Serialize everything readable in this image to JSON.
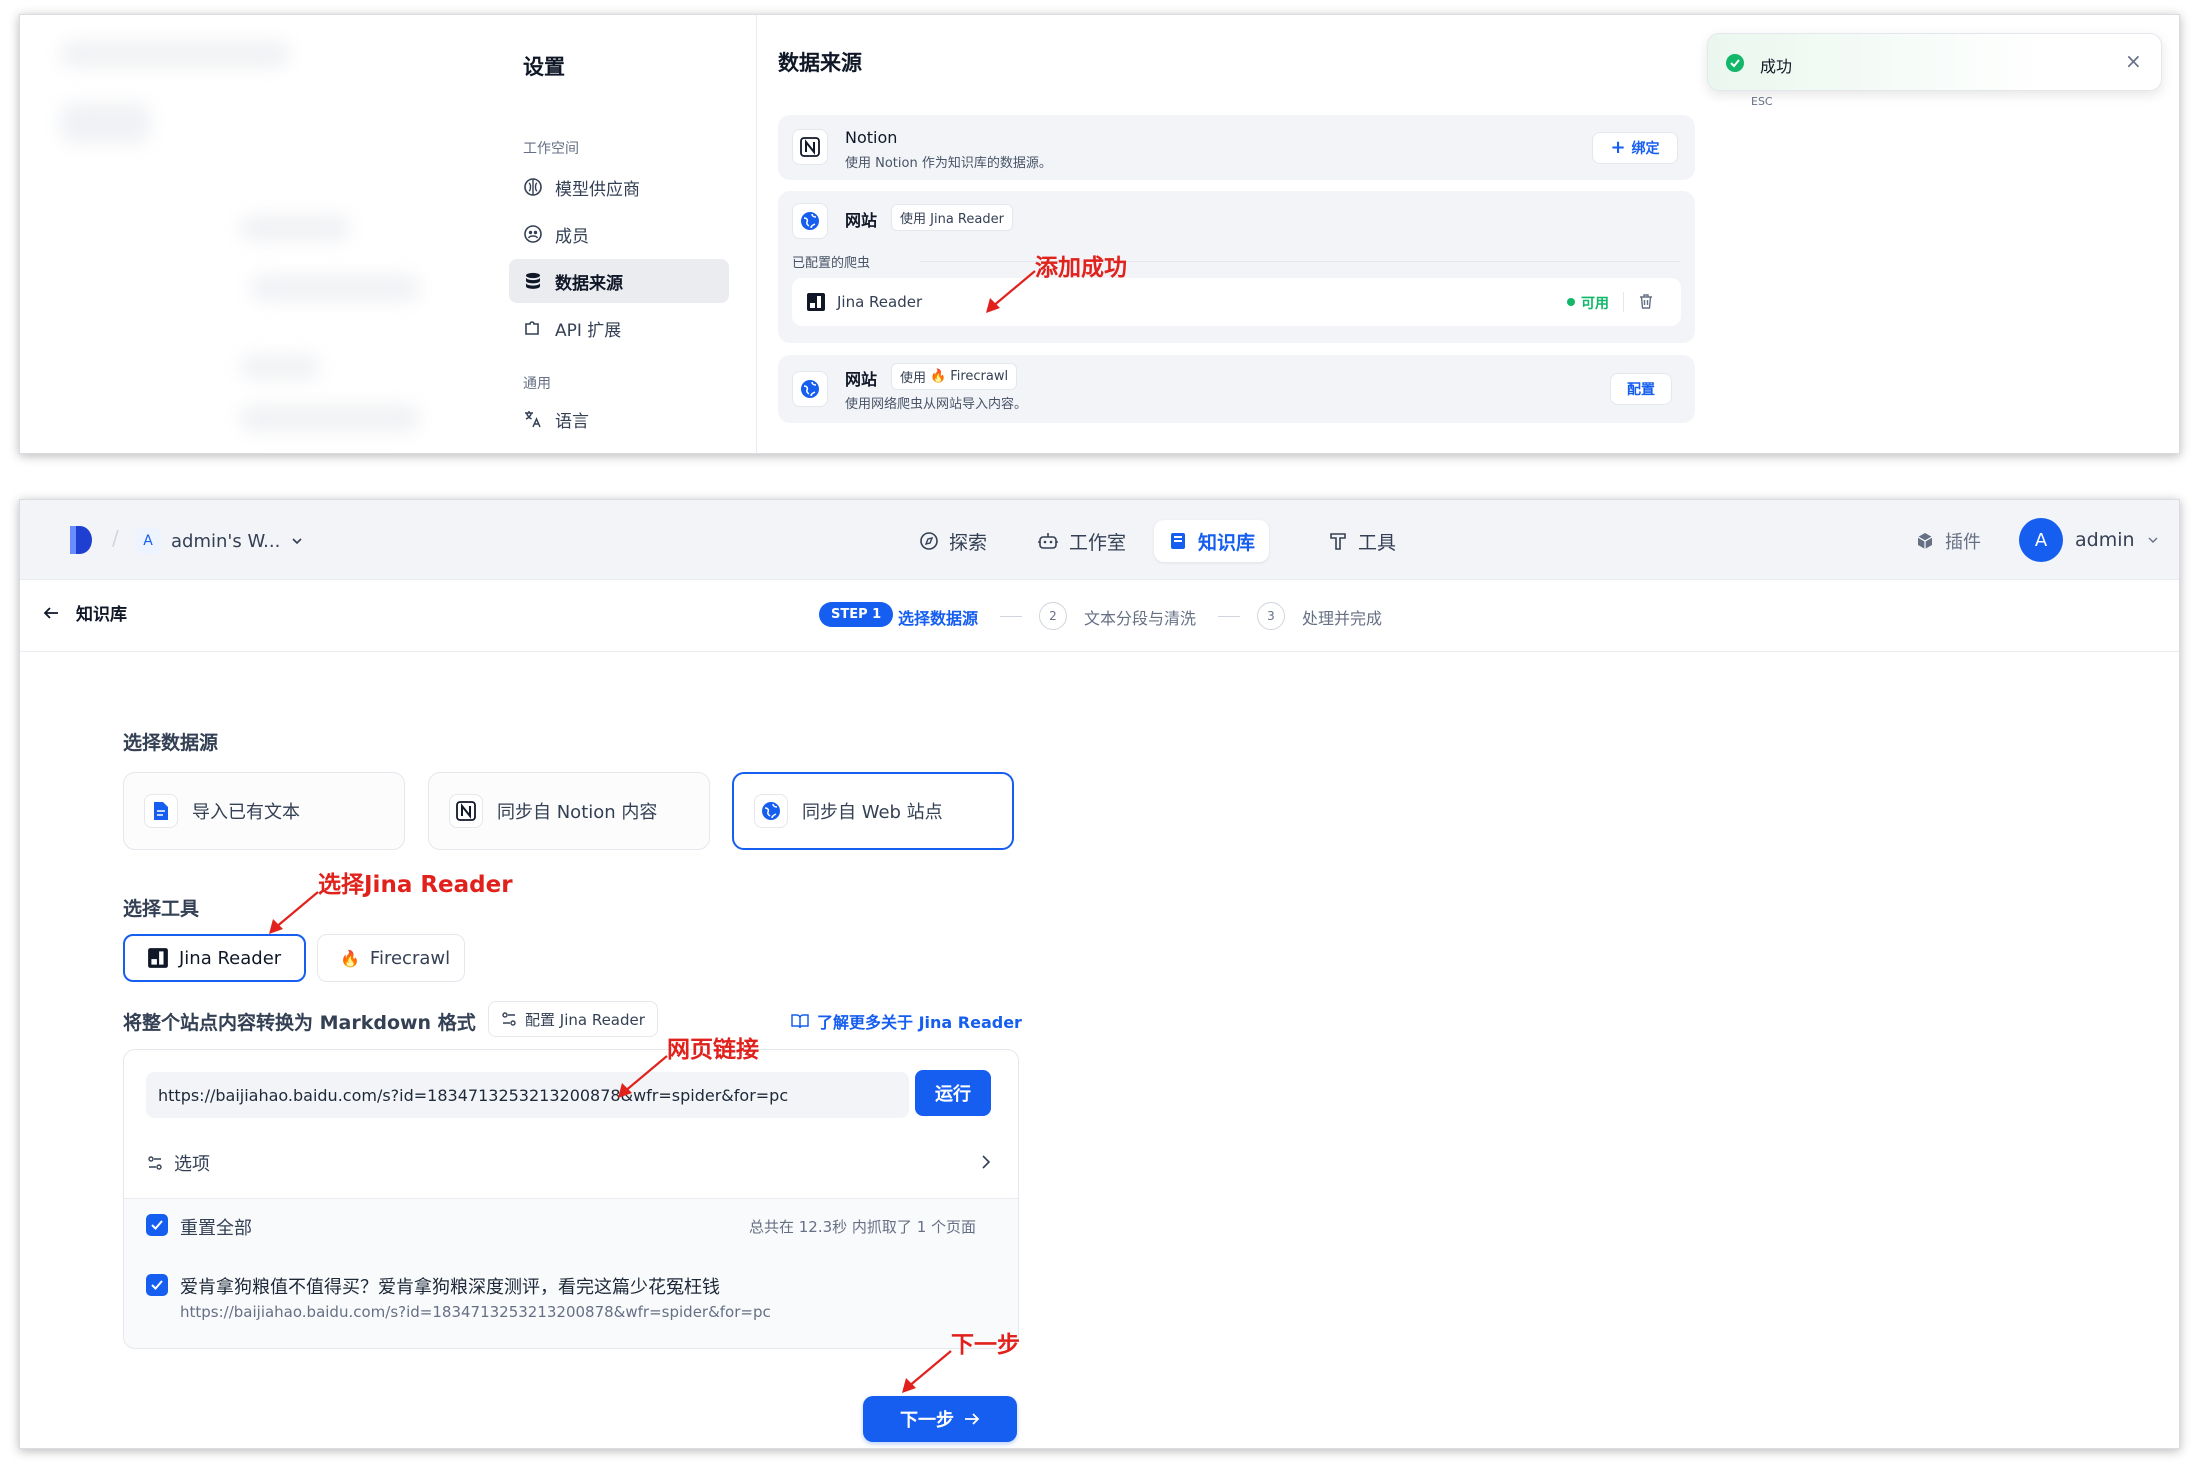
{
  "settings": {
    "title": "设置",
    "group_workspace": "工作空间",
    "group_general": "通用",
    "nav": [
      {
        "label": "模型供应商"
      },
      {
        "label": "成员"
      },
      {
        "label": "数据来源"
      },
      {
        "label": "API 扩展"
      },
      {
        "label": "语言"
      }
    ]
  },
  "datasource": {
    "title": "数据来源",
    "notion": {
      "name": "Notion",
      "desc": "使用 Notion 作为知识库的数据源。",
      "bind_label": "绑定"
    },
    "jina": {
      "name": "网站",
      "tag": "使用 Jina Reader",
      "configured_label": "已配置的爬虫",
      "crawler_name": "Jina Reader",
      "status": "可用"
    },
    "firecrawl": {
      "name": "网站",
      "tag_prefix": "使用",
      "tag_name": "Firecrawl",
      "desc": "使用网络爬虫从网站导入内容。",
      "config_label": "配置"
    }
  },
  "toast": {
    "text": "成功",
    "esc": "ESC"
  },
  "annotations": {
    "add_success": "添加成功",
    "select_jina": "选择Jina Reader",
    "web_link": "网页链接",
    "next": "下一步"
  },
  "header": {
    "workspace_initial": "A",
    "workspace_name": "admin's W...",
    "tabs": [
      {
        "label": "探索"
      },
      {
        "label": "工作室"
      },
      {
        "label": "知识库"
      },
      {
        "label": "工具"
      }
    ],
    "plugins": "插件",
    "user_initial": "A",
    "user_name": "admin"
  },
  "stepbar": {
    "back_label": "知识库",
    "step1_badge": "STEP 1",
    "step1_label": "选择数据源",
    "step2_num": "2",
    "step2_label": "文本分段与清洗",
    "step3_num": "3",
    "step3_label": "处理并完成"
  },
  "form": {
    "source_title": "选择数据源",
    "sources": [
      {
        "label": "导入已有文本"
      },
      {
        "label": "同步自 Notion 内容"
      },
      {
        "label": "同步自 Web 站点"
      }
    ],
    "tool_title": "选择工具",
    "tools": [
      {
        "label": "Jina Reader"
      },
      {
        "label": "Firecrawl"
      }
    ],
    "convert_label": "将整个站点内容转换为 Markdown 格式",
    "config_label": "配置 Jina Reader",
    "learn_more": "了解更多关于 Jina Reader",
    "url_value": "https://baijiahao.baidu.com/s?id=1834713253213200878&wfr=spider&for=pc",
    "run_label": "运行",
    "options_label": "选项",
    "reset_all": "重置全部",
    "summary": "总共在 12.3秒 内抓取了 1 个页面",
    "result_title": "爱肯拿狗粮值不值得买？爱肯拿狗粮深度测评，看完这篇少花冤枉钱",
    "result_url": "https://baijiahao.baidu.com/s?id=1834713253213200878&wfr=spider&for=pc",
    "next_label": "下一步"
  },
  "colors": {
    "accent": "#155eef",
    "annotation": "#e1211b",
    "success": "#12b76a"
  }
}
